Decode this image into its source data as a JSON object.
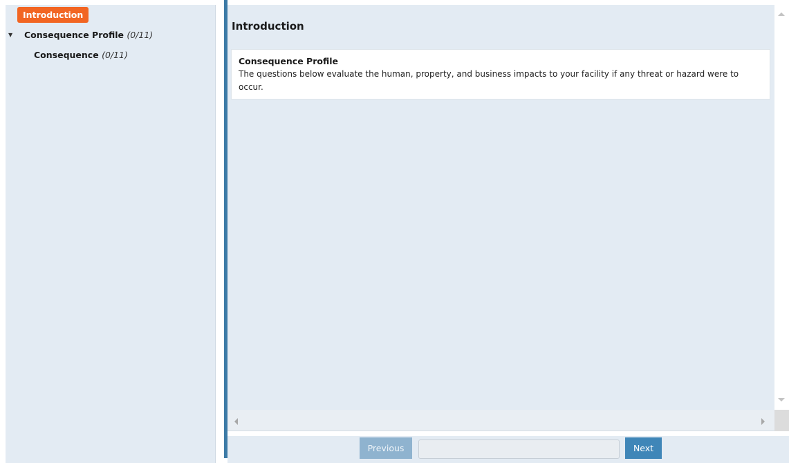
{
  "sidebar": {
    "intro_label": "Introduction",
    "items": [
      {
        "label": "Consequence Profile",
        "count": "(0/11)",
        "expanded": true
      },
      {
        "label": "Consequence",
        "count": "(0/11)"
      }
    ]
  },
  "main": {
    "title": "Introduction",
    "card": {
      "title": "Consequence Profile",
      "body": "The questions below evaluate the human, property, and business impacts to your facility if any threat or hazard were to occur."
    }
  },
  "footer": {
    "previous_label": "Previous",
    "next_label": "Next",
    "progress_fraction": 0
  },
  "colors": {
    "accent": "#f26522",
    "primary": "#3f86b8",
    "panel": "#e3ebf3"
  }
}
